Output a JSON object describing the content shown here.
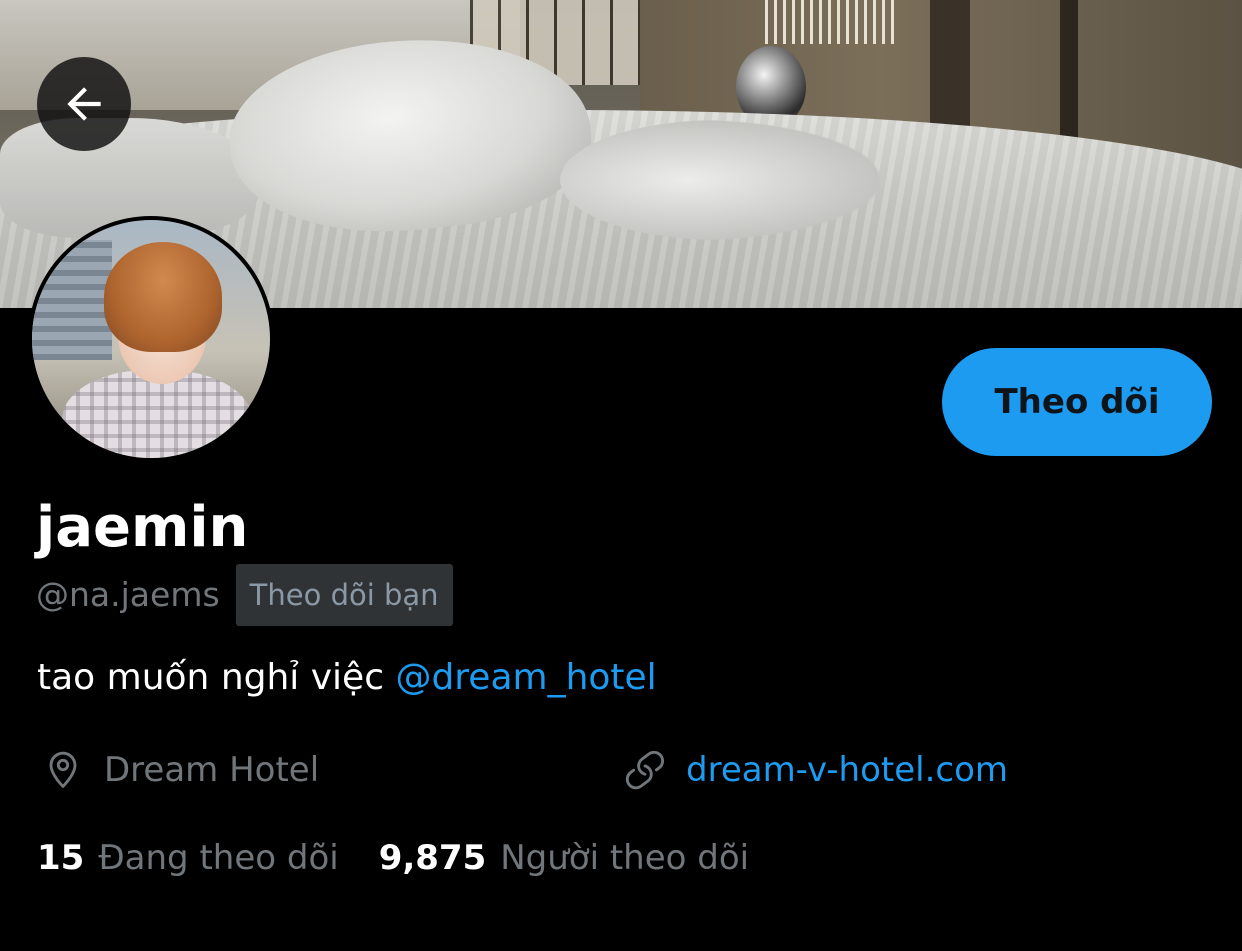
{
  "header": {
    "back_icon": "arrow-left-icon"
  },
  "profile": {
    "display_name": "jaemin",
    "handle": "@na.jaems",
    "follows_you_badge": "Theo dõi bạn",
    "follow_button_label": "Theo dõi",
    "bio": {
      "text": "tao muốn nghỉ việc ",
      "mention": "@dream_hotel"
    },
    "location": {
      "icon": "location-pin-icon",
      "text": "Dream Hotel"
    },
    "website": {
      "icon": "link-icon",
      "text": "dream-v-hotel.com"
    },
    "stats": {
      "following_count": "15",
      "following_label": "Đang theo dõi",
      "followers_count": "9,875",
      "followers_label": "Người theo dõi"
    }
  },
  "colors": {
    "background": "#000000",
    "accent": "#1d9bf0",
    "secondary_text": "#71767b",
    "badge_background": "#2f3336"
  }
}
